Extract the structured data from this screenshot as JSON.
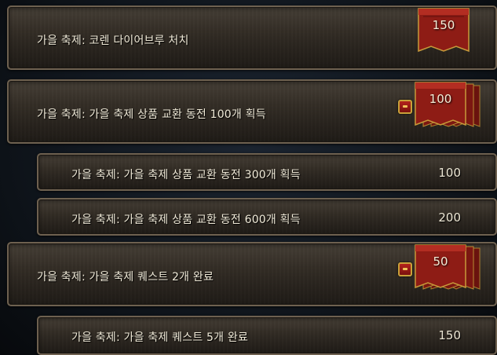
{
  "achievements": [
    {
      "title": "가을 축제: 코렌 다이어브루 처치",
      "points": "150",
      "stacked": false,
      "has_icon": false
    },
    {
      "title": "가을 축제: 가을 축제 상품 교환 동전 100개 획득",
      "points": "100",
      "stacked": true,
      "has_icon": true,
      "sub": [
        {
          "title": "가을 축제: 가을 축제 상품 교환 동전 300개 획득",
          "points": "100"
        },
        {
          "title": "가을 축제: 가을 축제 상품 교환 동전 600개 획득",
          "points": "200"
        }
      ]
    },
    {
      "title": "가을 축제: 가을 축제 퀘스트 2개 완료",
      "points": "50",
      "stacked": true,
      "has_icon": true,
      "sub": [
        {
          "title": "가을 축제: 가을 축제 퀘스트 5개 완료",
          "points": "150"
        }
      ]
    }
  ],
  "icons": {
    "banner": "red-banner-icon",
    "series_toggle": "red-toggle-icon"
  },
  "colors": {
    "panel": "#312b24",
    "border": "#6e6150",
    "text": "#f0ead8",
    "banner_red": "#a4241c",
    "banner_gold": "#c79a3a"
  }
}
